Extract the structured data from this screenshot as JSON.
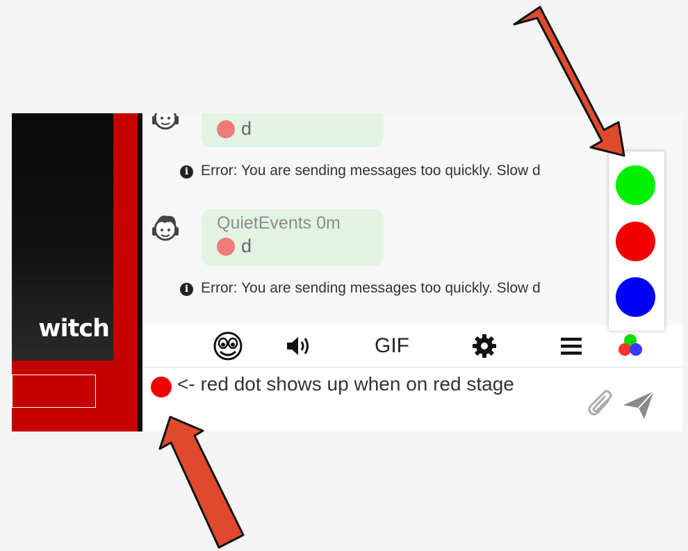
{
  "stream": {
    "logo_text": "witch"
  },
  "chat": {
    "messages": [
      {
        "username": "",
        "time": "",
        "text": "d",
        "stage_dot": "red-dot-icon"
      },
      {
        "username": "QuietEvents",
        "time": "0m",
        "text": "d",
        "stage_dot": "red-dot-icon"
      }
    ],
    "errors": [
      "Error: You are sending messages too quickly. Slow d",
      "Error: You are sending messages too quickly. Slow d"
    ]
  },
  "toolbar": {
    "items": [
      {
        "icon": "emoji-face-icon"
      },
      {
        "icon": "speaker-icon"
      },
      {
        "label": "GIF"
      },
      {
        "icon": "gear-icon"
      },
      {
        "icon": "menu-icon"
      },
      {
        "icon": "stage-colors-icon"
      }
    ]
  },
  "input": {
    "stage_indicator": {
      "color": "#f00000"
    },
    "value": "<- red dot shows up when on red stage"
  },
  "stage_menu": {
    "options": [
      {
        "name": "green",
        "color": "#00f000"
      },
      {
        "name": "red",
        "color": "#f00000"
      },
      {
        "name": "blue",
        "color": "#0000f5"
      }
    ]
  },
  "colors": {
    "stream_red": "#c40000",
    "bubble": "#e3f3e3",
    "arrow": "#df4a2d"
  }
}
